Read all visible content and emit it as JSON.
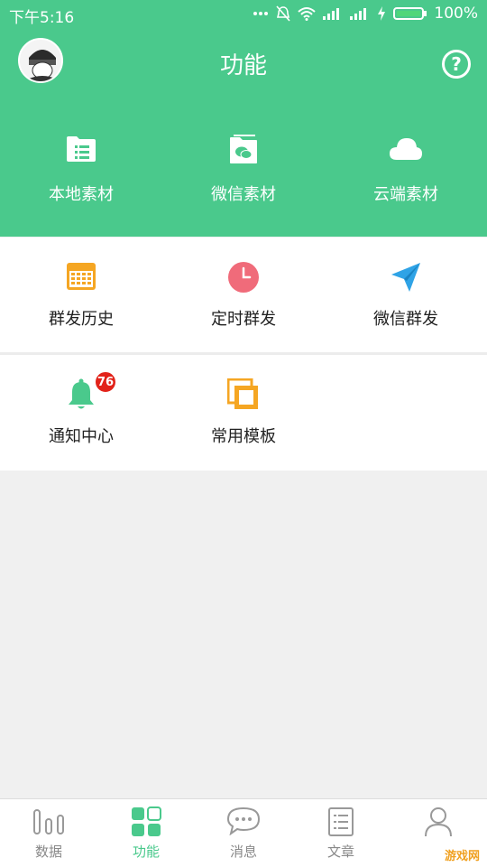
{
  "status": {
    "time": "下午5:16",
    "battery": "100%"
  },
  "header": {
    "title": "功能",
    "help": "?"
  },
  "top_items": [
    {
      "label": "本地素材",
      "icon": "folder-list-icon"
    },
    {
      "label": "微信素材",
      "icon": "wechat-folder-icon"
    },
    {
      "label": "云端素材",
      "icon": "cloud-icon"
    }
  ],
  "features": [
    {
      "label": "群发历史",
      "icon": "calendar-icon",
      "color": "#f5a623"
    },
    {
      "label": "定时群发",
      "icon": "clock-icon",
      "color": "#f06b7a"
    },
    {
      "label": "微信群发",
      "icon": "paper-plane-icon",
      "color": "#2fa3e6"
    },
    {
      "label": "通知中心",
      "icon": "bell-icon",
      "color": "#4ac98c",
      "badge": "76"
    },
    {
      "label": "常用模板",
      "icon": "template-icon",
      "color": "#f5a623"
    }
  ],
  "tabs": [
    {
      "label": "数据",
      "icon": "bar-chart-icon",
      "active": false
    },
    {
      "label": "功能",
      "icon": "grid-icon",
      "active": true
    },
    {
      "label": "消息",
      "icon": "chat-bubble-icon",
      "active": false
    },
    {
      "label": "文章",
      "icon": "document-icon",
      "active": false
    },
    {
      "label": "",
      "icon": "person-icon",
      "active": false
    }
  ],
  "watermark": "游戏网",
  "colors": {
    "brand": "#4ac98c",
    "badge": "#e2231a"
  }
}
